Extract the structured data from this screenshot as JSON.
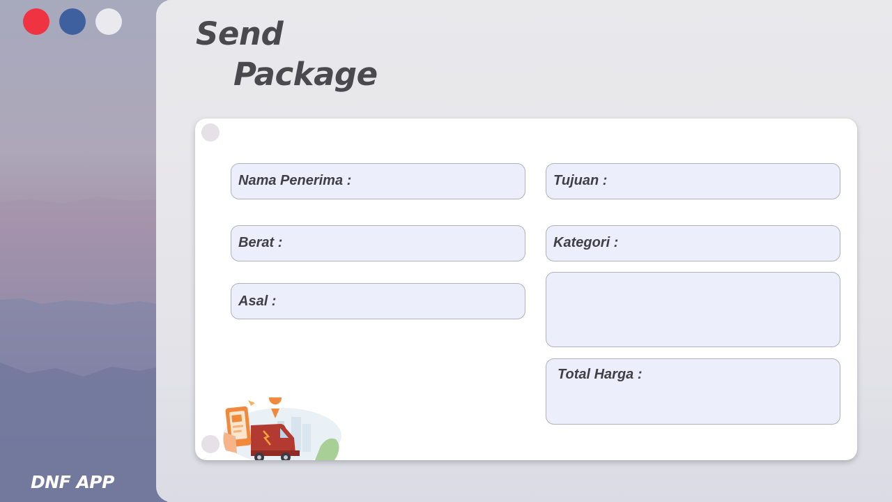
{
  "window_controls": {
    "close_color": "#ef3340",
    "minimize_color": "#3f609e",
    "maximize_color": "#e9e9ee"
  },
  "sidebar": {
    "brand": "DNF APP"
  },
  "page": {
    "title_line1": "Send",
    "title_line2": "Package"
  },
  "form": {
    "nama_penerima_label": "Nama Penerima :",
    "tujuan_label": "Tujuan :",
    "berat_label": "Berat :",
    "kategori_label": "Kategori :",
    "asal_label": "Asal :",
    "total_harga_label": "Total Harga :"
  },
  "illustration": "delivery-van-with-phone-and-location-pin"
}
